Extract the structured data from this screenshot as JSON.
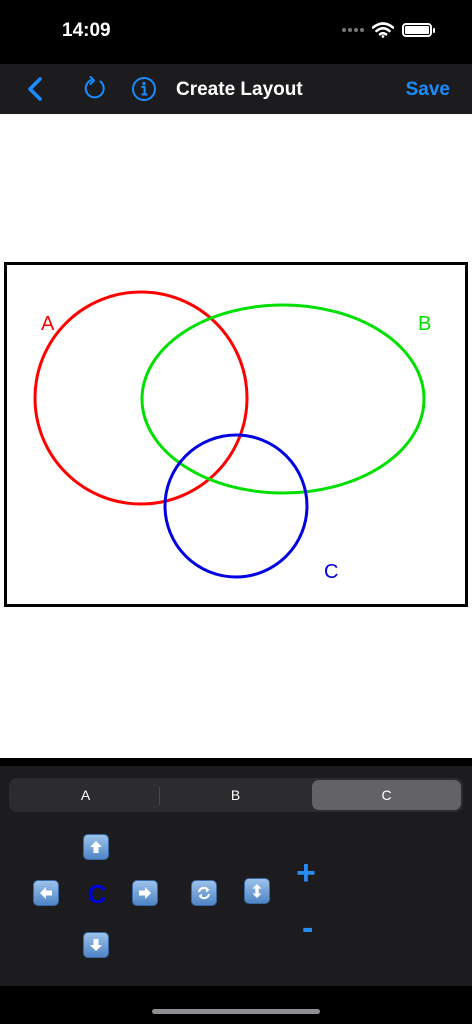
{
  "status_bar": {
    "time": "14:09"
  },
  "nav": {
    "title": "Create Layout",
    "save_label": "Save"
  },
  "diagram": {
    "sets": [
      {
        "label": "A",
        "color": "#ff0000"
      },
      {
        "label": "B",
        "color": "#00e000"
      },
      {
        "label": "C",
        "color": "#0000e0"
      }
    ]
  },
  "controls": {
    "segments": [
      "A",
      "B",
      "C"
    ],
    "selected_segment": "C",
    "selected_label": "C",
    "plus_label": "+",
    "minus_label": "-"
  },
  "icons": [
    "back-chevron-icon",
    "refresh-icon",
    "info-icon",
    "arrow-up-icon",
    "arrow-left-icon",
    "arrow-right-icon",
    "arrow-down-icon",
    "rotate-icon",
    "vertical-resize-icon"
  ]
}
